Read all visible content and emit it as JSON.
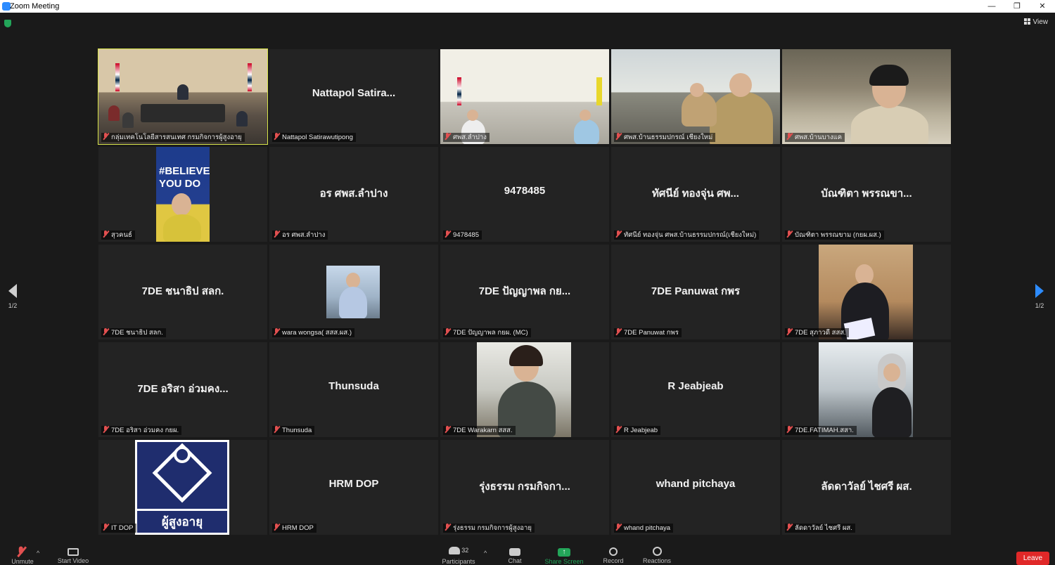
{
  "window": {
    "title": "Zoom Meeting",
    "minimize": "—",
    "restore": "❐",
    "close": "✕"
  },
  "header": {
    "view_label": "View"
  },
  "nav": {
    "prev_page": "1/2",
    "next_page": "1/2"
  },
  "participants": [
    {
      "label": "กลุ่มเทคโนโลยีสารสนเทศ กรมกิจการผู้สูงอายุ",
      "video": "room",
      "active": true
    },
    {
      "label": "Nattapol Satirawutipong",
      "big": "Nattapol Satira..."
    },
    {
      "label": "ศพส.ลำปาง",
      "video": "center"
    },
    {
      "label": "ศพส.บ้านธรรมปกรณ์ เชียงใหม่",
      "video": "office"
    },
    {
      "label": "ศพส.บ้านบางแค",
      "video": "desk"
    },
    {
      "label": "สุวคนธ์",
      "video": "believe",
      "thumb_text": "#BELIEVE YOU DO"
    },
    {
      "label": "อร ศพส.ลำปาง",
      "big": "อร ศพส.ลำปาง"
    },
    {
      "label": "9478485",
      "big": "9478485"
    },
    {
      "label": "ทัศนีย์ ทองจุ่น ศพส.บ้านธรรมปกรณ์(เชียงใหม่)",
      "big": "ทัศนีย์ ทองจุ่น ศพ..."
    },
    {
      "label": "บัณฑิตา พรรณขาม (กยผ.ผส.)",
      "big": "บัณฑิตา พรรณขา..."
    },
    {
      "label": "7DE ชนาธิป สลก.",
      "big": "7DE ชนาธิป สลก."
    },
    {
      "label": "wara wongsa( สสส.ผส.)",
      "video": "wara"
    },
    {
      "label": "7DE ปัญญาพล กยผ. (MC)",
      "big": "7DE ปัญญาพล กย..."
    },
    {
      "label": "7DE Panuwat กพร",
      "big": "7DE Panuwat กพร"
    },
    {
      "label": "7DE สุภาวดี สสส.",
      "video": "suparat"
    },
    {
      "label": "7DE อริสา อ่วมคง กยผ.",
      "big": "7DE อริสา อ่วมคง..."
    },
    {
      "label": "Thunsuda",
      "big": "Thunsuda"
    },
    {
      "label": "7DE Warakarn สสส.",
      "video": "warakarn"
    },
    {
      "label": "R Jeabjeab",
      "big": "R Jeabjeab"
    },
    {
      "label": "7DE.FATIMAH.สสา.",
      "video": "fatimah"
    },
    {
      "label": "IT DOP",
      "video": "logo",
      "logo_text": "ผู้สูงอายุ"
    },
    {
      "label": "HRM DOP",
      "big": "HRM DOP"
    },
    {
      "label": "รุ่งธรรม กรมกิจการผู้สูงอายุ",
      "big": "รุ่งธรรม กรมกิจกา..."
    },
    {
      "label": "whand pitchaya",
      "big": "whand pitchaya"
    },
    {
      "label": "ลัดดาวัลย์ ไชศรี ผส.",
      "big": "ลัดดาวัลย์ ไชศรี ผส."
    }
  ],
  "toolbar": {
    "unmute": "Unmute",
    "start_video": "Start Video",
    "participants_count": "32",
    "participants": "Participants",
    "chat": "Chat",
    "share_screen": "Share Screen",
    "record": "Record",
    "reactions": "Reactions",
    "leave": "Leave"
  },
  "colors": {
    "active_border": "#d7e44a",
    "leave": "#e02828",
    "share": "#23a559",
    "accent": "#2d8cff"
  }
}
